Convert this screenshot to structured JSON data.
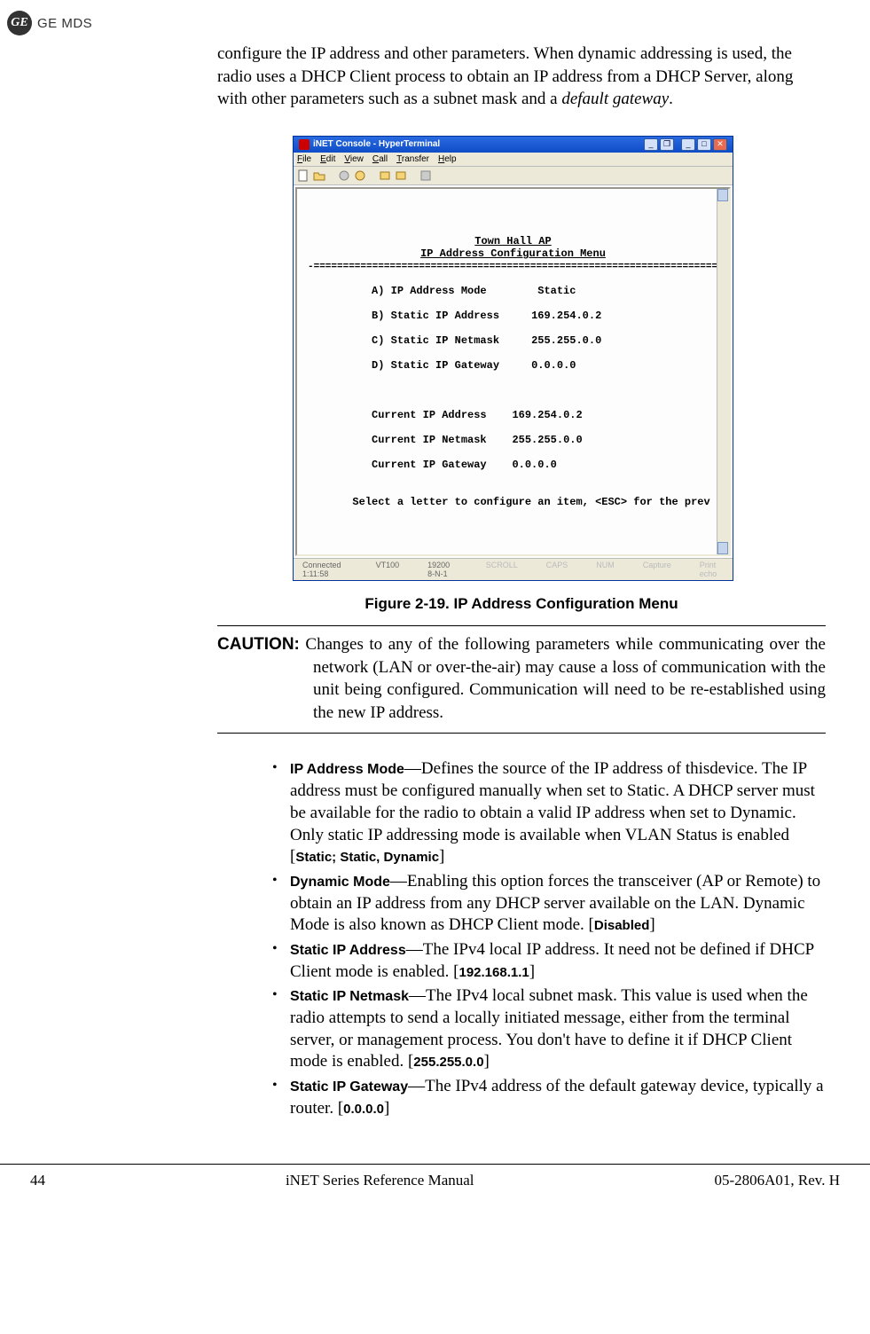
{
  "header": {
    "logo_text": "GE",
    "brand": "GE MDS"
  },
  "intro": {
    "text_part1": "configure the IP address and other parameters. When dynamic addressing is used, the radio uses a DHCP Client process to obtain an IP address from a DHCP Server, along with other parameters such as a subnet mask and a ",
    "text_italic": "default gateway",
    "text_part2": "."
  },
  "terminal": {
    "title": "iNET Console - HyperTerminal",
    "menu": [
      "File",
      "Edit",
      "View",
      "Call",
      "Transfer",
      "Help"
    ],
    "body_title": "Town Hall AP",
    "body_subtitle": "IP Address Configuration Menu",
    "separator": "-==========================================================================-",
    "items": [
      {
        "key": "A) IP Address Mode",
        "val": "Static"
      },
      {
        "key": "B) Static IP Address",
        "val": "169.254.0.2"
      },
      {
        "key": "C) Static IP Netmask",
        "val": "255.255.0.0"
      },
      {
        "key": "D) Static IP Gateway",
        "val": "0.0.0.0"
      }
    ],
    "current": [
      {
        "key": "Current IP Address",
        "val": "169.254.0.2"
      },
      {
        "key": "Current IP Netmask",
        "val": "255.255.0.0"
      },
      {
        "key": "Current IP Gateway",
        "val": "0.0.0.0"
      }
    ],
    "prompt": "Select a letter to configure an item, <ESC> for the prev menu",
    "status": {
      "time": "Connected 1:11:58",
      "emu": "VT100",
      "speed": "19200 8-N-1",
      "scroll": "SCROLL",
      "caps": "CAPS",
      "num": "NUM",
      "capture": "Capture",
      "print": "Print echo"
    }
  },
  "figure_caption": "Figure 2-19. IP Address Configuration Menu",
  "caution": {
    "label": "CAUTION:",
    "text": " Changes to any of the following parameters while communicating over the network (LAN or over-the-air) may cause a loss of communication with the unit being configured. Communication will need to be re-established using the new IP address."
  },
  "bullets": {
    "b1": {
      "term": "IP Address Mode",
      "desc_a": "—Defines the source of the IP address of thisdevice. The IP address must be configured manually when set to Static. A DHCP server must be available for the radio to obtain a valid IP address when set to Dynamic. Only static IP addressing mode is available when VLAN Status is enabled [",
      "val": "Static; Static, Dynamic",
      "desc_b": "]"
    },
    "b2": {
      "term": "Dynamic Mode",
      "desc_a": "—Enabling this option forces the transceiver (AP or Remote) to obtain an IP address from any DHCP server available on the LAN. Dynamic Mode is also known as DHCP Client mode. [",
      "val": "Disabled",
      "desc_b": "]"
    },
    "b3": {
      "term": "Static IP Address",
      "desc_a": "—The IPv4 local IP address. It need not be defined if DHCP Client mode is enabled. [",
      "val": "192.168.1.1",
      "desc_b": "]"
    },
    "b4": {
      "term": "Static IP Netmask",
      "desc_a": "—The IPv4 local subnet mask. This value is used when the radio attempts to send a locally initiated message, either from the terminal server, or management process. You don't have to define it if DHCP Client mode is enabled. [",
      "val": "255.255.0.0",
      "desc_b": "]"
    },
    "b5": {
      "term": "Static IP Gateway",
      "desc_a": "—The IPv4 address of the default gateway device, typically a router. [",
      "val": "0.0.0.0",
      "desc_b": "]"
    }
  },
  "footer": {
    "page": "44",
    "center": "iNET Series Reference Manual",
    "right": "05-2806A01, Rev. H"
  }
}
